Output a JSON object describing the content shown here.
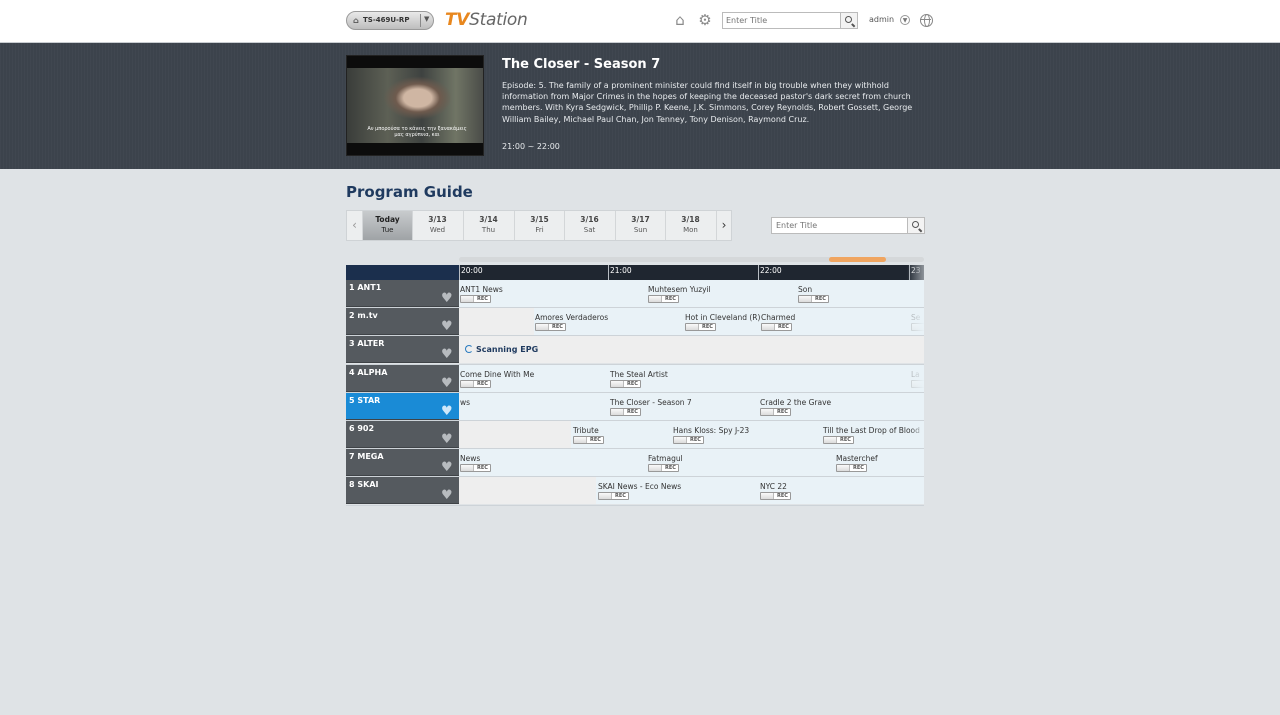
{
  "header": {
    "device": "TS-469U-RP",
    "logo_tv": "TV",
    "logo_station": "Station",
    "search_placeholder": "Enter Title",
    "user": "admin"
  },
  "now_playing": {
    "title": "The Closer - Season 7",
    "description": "Episode: 5. The family of a prominent minister could find itself in big trouble when they withhold information from Major Crimes in the hopes of keeping the deceased pastor's dark secret from church members. With Kyra Sedgwick, Phillip P. Keene, J.K. Simmons, Corey Reynolds, Robert Gossett, George William Bailey, Michael Paul Chan, Jon Tenney, Tony Denison, Raymond Cruz.",
    "time": "21:00 ~ 22:00",
    "subtitle": "Αν μπορούσα το κάνεις την ξανακάμεις μας αγρύπνια, και"
  },
  "guide": {
    "title": "Program Guide",
    "search_placeholder": "Enter Title",
    "days": [
      {
        "date": "Today",
        "weekday": "Tue",
        "active": true
      },
      {
        "date": "3/13",
        "weekday": "Wed"
      },
      {
        "date": "3/14",
        "weekday": "Thu"
      },
      {
        "date": "3/15",
        "weekday": "Fri"
      },
      {
        "date": "3/16",
        "weekday": "Sat"
      },
      {
        "date": "3/17",
        "weekday": "Sun"
      },
      {
        "date": "3/18",
        "weekday": "Mon"
      }
    ],
    "times": [
      "20:00",
      "21:00",
      "22:00",
      "23"
    ],
    "rec_label": "REC",
    "scanning_label": "Scanning EPG",
    "channels": [
      {
        "name": "1 ANT1",
        "programs": [
          "ANT1 News",
          "Muhtesem Yuzyil",
          "Son"
        ]
      },
      {
        "name": "2 m.tv",
        "programs": [
          "Amores Verdaderos",
          "Hot in Cleveland (R)",
          "Charmed",
          "Se"
        ]
      },
      {
        "name": "3 ALTER",
        "programs": []
      },
      {
        "name": "4 ALPHA",
        "programs": [
          "Come Dine With Me",
          "The Steal Artist",
          "La"
        ]
      },
      {
        "name": "5 STAR",
        "selected": true,
        "programs": [
          "ws",
          "The Closer - Season 7",
          "Cradle 2 the Grave"
        ]
      },
      {
        "name": "6 902",
        "programs": [
          "Tribute",
          "Hans Kloss: Spy J-23",
          "Till the Last Drop of Blood"
        ]
      },
      {
        "name": "7 MEGA",
        "programs": [
          "News",
          "Fatmagul",
          "Masterchef"
        ]
      },
      {
        "name": "8 SKAI",
        "programs": [
          "SKAI News - Eco News",
          "NYC 22"
        ]
      }
    ]
  }
}
